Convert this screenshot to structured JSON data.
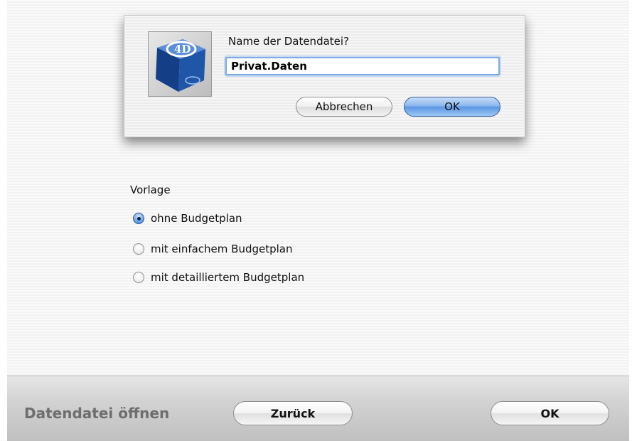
{
  "dialog": {
    "prompt": "Name der Datendatei?",
    "filename_value": "Privat.Daten",
    "cancel_label": "Abbrechen",
    "ok_label": "OK",
    "icon": "4d-cube-icon"
  },
  "template_group": {
    "label": "Vorlage",
    "options": [
      {
        "label": "ohne Budgetplan",
        "selected": true
      },
      {
        "label": "mit einfachem Budgetplan",
        "selected": false
      },
      {
        "label": "mit detailliertem Budgetplan",
        "selected": false
      }
    ]
  },
  "footer": {
    "title": "Datendatei öffnen",
    "back_label": "Zurück",
    "ok_label": "OK"
  },
  "colors": {
    "default_button": "#5d95e2",
    "focus_ring": "#7fa9e0"
  }
}
